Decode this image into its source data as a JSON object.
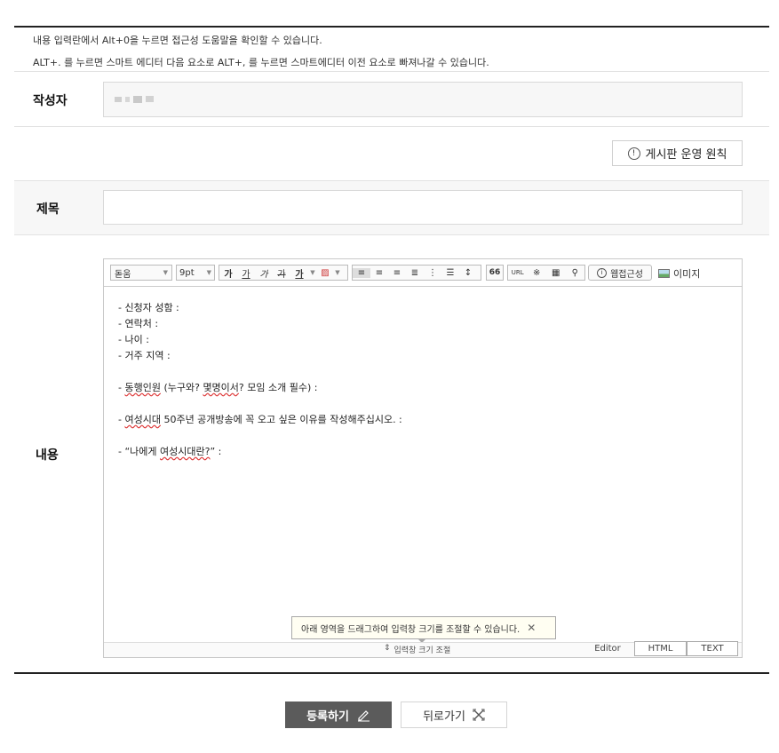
{
  "help": {
    "line1": "내용 입력란에서 Alt+0을 누르면 접근성 도움말을 확인할 수 있습니다.",
    "line2": "ALT+. 를 누르면 스마트 에디터 다음 요소로 ALT+, 를 누르면 스마트에디터 이전 요소로 빠져나갈 수 있습니다."
  },
  "author": {
    "label": "작성자",
    "value": ""
  },
  "policy_button": {
    "label": "게시판 운영 원칙",
    "icon": "alert-circle-icon"
  },
  "subject": {
    "label": "제목",
    "value": ""
  },
  "content": {
    "label": "내용"
  },
  "toolbar": {
    "font": "돋움",
    "size": "9pt",
    "bold": "가",
    "underline": "가",
    "italic": "가",
    "strike": "가",
    "fontcolor": "가",
    "quote": "66",
    "url": "URL",
    "special": "※",
    "accessibility": "웹접근성",
    "image": "이미지"
  },
  "editor_lines": [
    "- 신청자 성함 :",
    "- 연락처 :",
    "- 나이 :",
    "- 거주 지역 :",
    "",
    "- 동행인원 (누구와? 몇명이서? 모임 소개 필수) :",
    "",
    "- 여성시대 50주년 공개방송에 꼭 오고 싶은 이유를 작성해주십시오. :",
    "",
    "- “나에게 여성시대란?” :"
  ],
  "resize_tip": "아래 영역을 드래그하여 입력창 크기를 조절할 수 있습니다.",
  "resize_handle": "입력창 크기 조절",
  "modes": [
    "Editor",
    "HTML",
    "TEXT"
  ],
  "buttons": {
    "submit": "등록하기",
    "back": "뒤로가기"
  }
}
